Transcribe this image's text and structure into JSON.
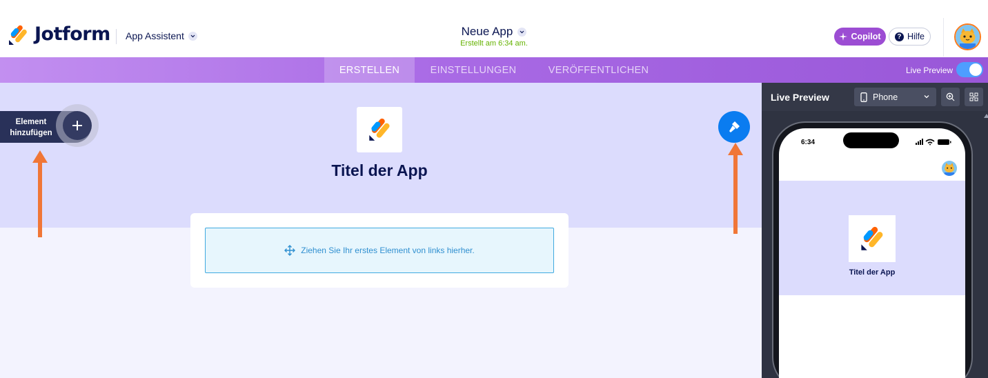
{
  "header": {
    "brand": "Jotform",
    "assistant_label": "App Assistent",
    "app_name": "Neue App",
    "app_created": "Erstellt am 6:34 am.",
    "copilot_label": "Copilot",
    "help_label": "Hilfe"
  },
  "tabs": [
    {
      "label": "ERSTELLEN",
      "active": true
    },
    {
      "label": "EINSTELLUNGEN",
      "active": false
    },
    {
      "label": "VERÖFFENTLICHEN",
      "active": false
    }
  ],
  "live_preview_toggle": {
    "label": "Live Preview",
    "on": true
  },
  "builder": {
    "add_element_label": "Element hinzufügen",
    "app_title": "Titel der App",
    "dropzone_text": "Ziehen Sie Ihr erstes Element von links hierher."
  },
  "preview_panel": {
    "title": "Live Preview",
    "device": "Phone",
    "phone_time": "6:34",
    "phone_app_title": "Titel der App"
  },
  "colors": {
    "brand_navy": "#0a1551",
    "accent_purple": "#9c4dd3",
    "hero_bg": "#dcdcfd",
    "created_green": "#64b200",
    "primary_blue": "#0a7cf0",
    "annotation_arrow": "#f07637"
  }
}
